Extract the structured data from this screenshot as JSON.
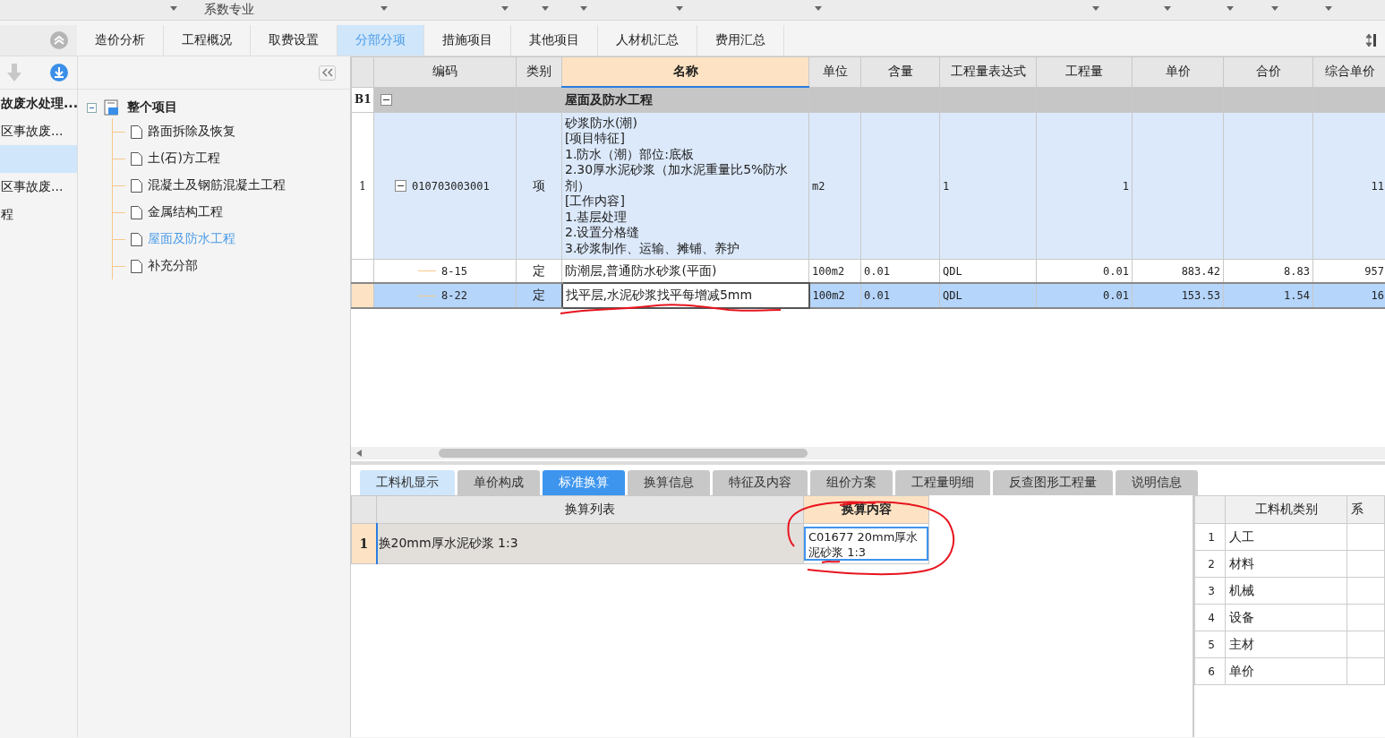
{
  "header_bar": {
    "label": "系数专业"
  },
  "tabs": [
    {
      "label": "造价分析",
      "selected": false
    },
    {
      "label": "工程概况",
      "selected": false
    },
    {
      "label": "取费设置",
      "selected": false
    },
    {
      "label": "分部分项",
      "selected": true
    },
    {
      "label": "措施项目",
      "selected": false
    },
    {
      "label": "其他项目",
      "selected": false
    },
    {
      "label": "人材机汇总",
      "selected": false
    },
    {
      "label": "费用汇总",
      "selected": false
    }
  ],
  "side_list": [
    {
      "label": "故废水处理...",
      "bold": true,
      "selected": false
    },
    {
      "label": "区事故废...",
      "bold": false,
      "selected": false
    },
    {
      "bold": false,
      "selected": true
    },
    {
      "label": "区事故废...",
      "bold": false,
      "selected": false
    },
    {
      "label": "程",
      "bold": false,
      "selected": false
    }
  ],
  "tree": {
    "label": "整个项目",
    "expanded": true,
    "children": [
      {
        "label": "路面拆除及恢复",
        "selected": false
      },
      {
        "label": "土(石)方工程",
        "selected": false
      },
      {
        "label": "混凝土及钢筋混凝土工程",
        "selected": false
      },
      {
        "label": "金属结构工程",
        "selected": false
      },
      {
        "label": "屋面及防水工程",
        "selected": true
      },
      {
        "label": "补充分部",
        "selected": false
      }
    ]
  },
  "grid": {
    "columns": [
      "编码",
      "类别",
      "名称",
      "单位",
      "含量",
      "工程量表达式",
      "工程量",
      "单价",
      "合价",
      "综合单价"
    ],
    "rows": [
      {
        "kind": "section",
        "number": "B1",
        "expanded": true,
        "selected": false,
        "cells": [
          "",
          "",
          "屋面及防水工程",
          "",
          "",
          "",
          "",
          "",
          "",
          ""
        ],
        "children": [
          {
            "kind": "item",
            "number": "1",
            "expanded": true,
            "selected": false,
            "cells": [
              "010703003001",
              "项",
              "砂浆防水(潮)\n[项目特征]\n1.防水（潮）部位:底板\n2.30厚水泥砂浆（加水泥重量比5%防水剂）\n[工作内容]\n1.基层处理\n2.设置分格缝\n3.砂浆制作、运输、摊铺、养护",
              "m2",
              "",
              "1",
              "1",
              "",
              "",
              "11"
            ],
            "children": [
              {
                "kind": "quota",
                "selected": false,
                "cells": [
                  "8-15",
                  "定",
                  "防潮层,普通防水砂浆(平面)",
                  "100m2",
                  "0.01",
                  "QDL",
                  "0.01",
                  "883.42",
                  "8.83",
                  "957"
                ]
              },
              {
                "kind": "quota",
                "selected": true,
                "cells": [
                  "8-22",
                  "定",
                  "找平层,水泥砂浆找平每增减5mm",
                  "100m2",
                  "0.01",
                  "QDL",
                  "0.01",
                  "153.53",
                  "1.54",
                  "16"
                ]
              }
            ]
          }
        ]
      }
    ]
  },
  "bottom_tabs": [
    {
      "label": "工料机显示",
      "selected": false,
      "highlighted": true
    },
    {
      "label": "单价构成",
      "selected": false,
      "highlighted": false
    },
    {
      "label": "标准换算",
      "selected": true,
      "highlighted": false
    },
    {
      "label": "换算信息",
      "selected": false,
      "highlighted": false
    },
    {
      "label": "特征及内容",
      "selected": false,
      "highlighted": false
    },
    {
      "label": "组价方案",
      "selected": false,
      "highlighted": false
    },
    {
      "label": "工程量明细",
      "selected": false,
      "highlighted": false
    },
    {
      "label": "反查图形工程量",
      "selected": false,
      "highlighted": false
    },
    {
      "label": "说明信息",
      "selected": false,
      "highlighted": false
    }
  ],
  "conversion": {
    "columns": [
      "换算列表",
      "换算内容"
    ],
    "rows": [
      {
        "number": "1",
        "item": "换20mm厚水泥砂浆 1:3",
        "content": "C01677  20mm厚水泥砂浆 1:3"
      }
    ]
  },
  "categories": {
    "columns": [
      "工料机类别",
      "系"
    ],
    "rows": [
      {
        "number": "1",
        "label": "人工"
      },
      {
        "number": "2",
        "label": "材料"
      },
      {
        "number": "3",
        "label": "机械"
      },
      {
        "number": "4",
        "label": "设备"
      },
      {
        "number": "5",
        "label": "主材"
      },
      {
        "number": "6",
        "label": "单价"
      }
    ]
  }
}
